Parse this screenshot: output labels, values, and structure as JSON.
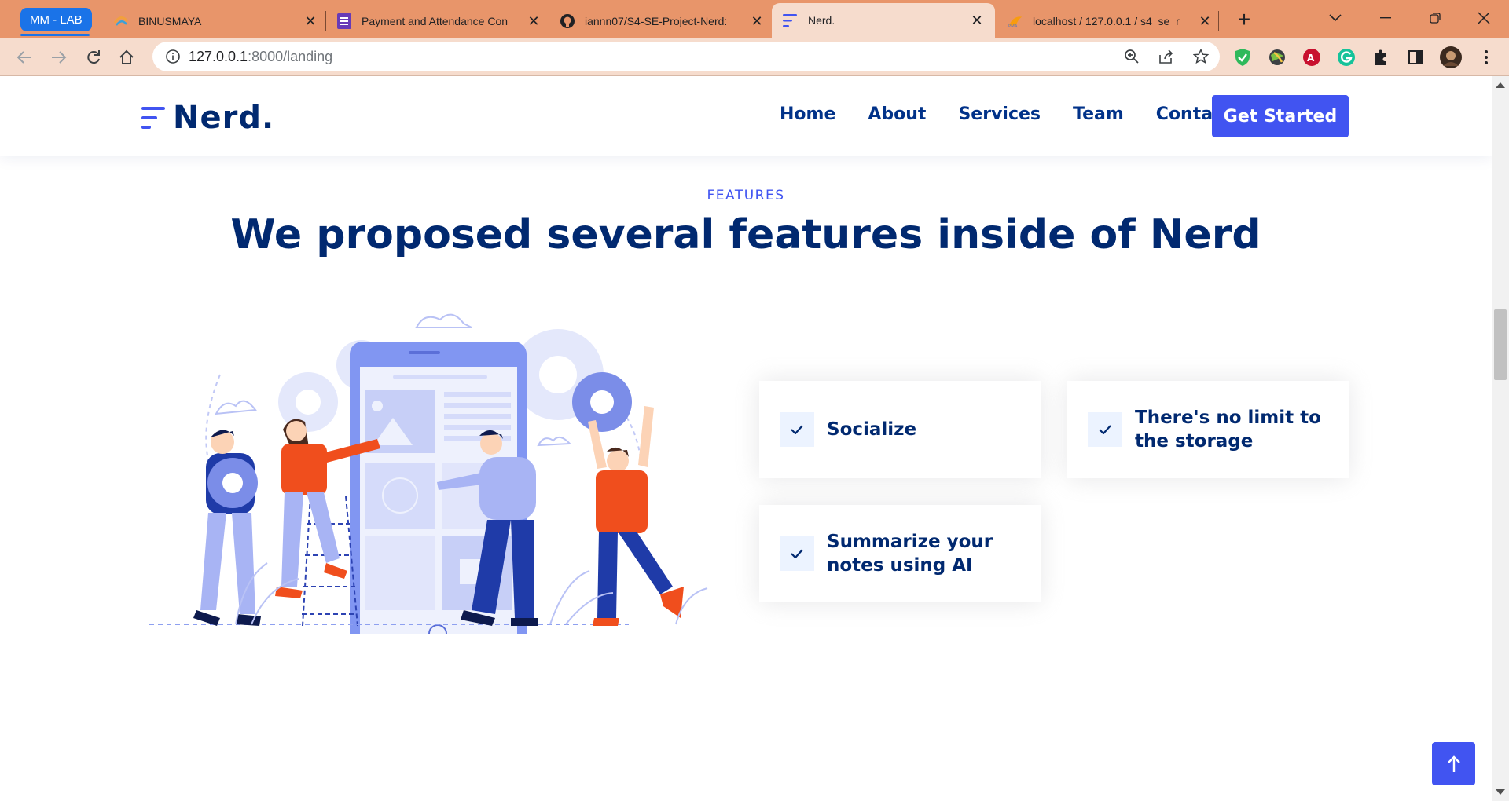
{
  "browser": {
    "tab_group_label": "MM - LAB",
    "tabs": [
      {
        "title": "BINUSMAYA",
        "icon": "binusmaya-icon"
      },
      {
        "title": "Payment and Attendance Con",
        "icon": "forms-icon"
      },
      {
        "title": "iannn07/S4-SE-Project-Nerd:",
        "icon": "github-icon"
      },
      {
        "title": "Nerd.",
        "icon": "nerd-logo-icon",
        "active": true
      },
      {
        "title": "localhost / 127.0.0.1 / s4_se_r",
        "icon": "phpmyadmin-icon"
      }
    ],
    "url_host": "127.0.0.1",
    "url_path": ":8000/landing"
  },
  "site": {
    "logo_text": "Nerd.",
    "nav": [
      "Home",
      "About",
      "Services",
      "Team",
      "Contact"
    ],
    "cta_label": "Get Started",
    "brand_color": "#4154f1",
    "navy_color": "#012970"
  },
  "features": {
    "eyebrow": "FEATURES",
    "headline": "We proposed several features inside of Nerd",
    "items": [
      {
        "label_line1": "Socialize",
        "label_line2": ""
      },
      {
        "label_line1": "There's no limit to",
        "label_line2": "the storage"
      },
      {
        "label_line1": "Summarize your",
        "label_line2": "notes using AI"
      }
    ]
  }
}
